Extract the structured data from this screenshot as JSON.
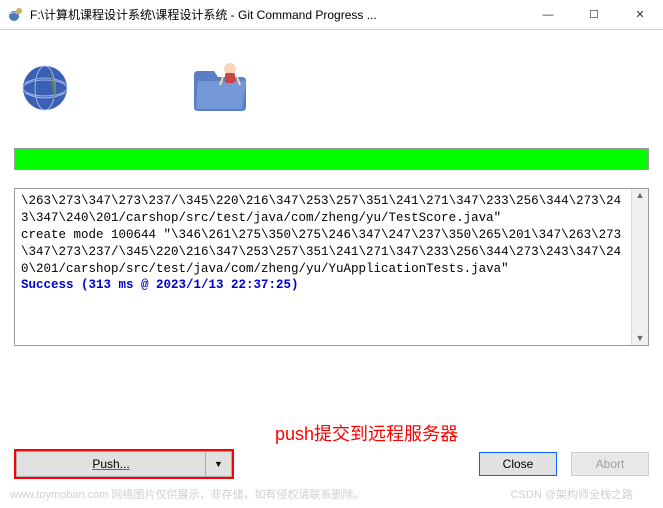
{
  "titlebar": {
    "title": "F:\\计算机课程设计系统\\课程设计系统 - Git Command Progress ..."
  },
  "log": {
    "line1": "\\263\\273\\347\\273\\237/\\345\\220\\216\\347\\253\\257\\351\\241\\271\\347\\233\\256\\344\\273\\243\\347\\240\\201/carshop/src/test/java/com/zheng/yu/TestScore.java\"",
    "line2": " create mode 100644 \"\\346\\261\\275\\350\\275\\246\\347\\247\\237\\350\\265\\201\\347\\263\\273\\347\\273\\237/\\345\\220\\216\\347\\253\\257\\351\\241\\271\\347\\233\\256\\344\\273\\243\\347\\240\\201/carshop/src/test/java/com/zheng/yu/YuApplicationTests.java\"",
    "blank": " ",
    "success": "Success (313 ms @ 2023/1/13 22:37:25)"
  },
  "annotation": "push提交到远程服务器",
  "buttons": {
    "push": "Push...",
    "dropdown_glyph": "▼",
    "close": "Close",
    "abort": "Abort"
  },
  "watermark1": "www.toymoban.com  网络图片仅供展示，非存储，如有侵权请联系删除。",
  "watermark2": "CSDN @架构师全栈之路"
}
